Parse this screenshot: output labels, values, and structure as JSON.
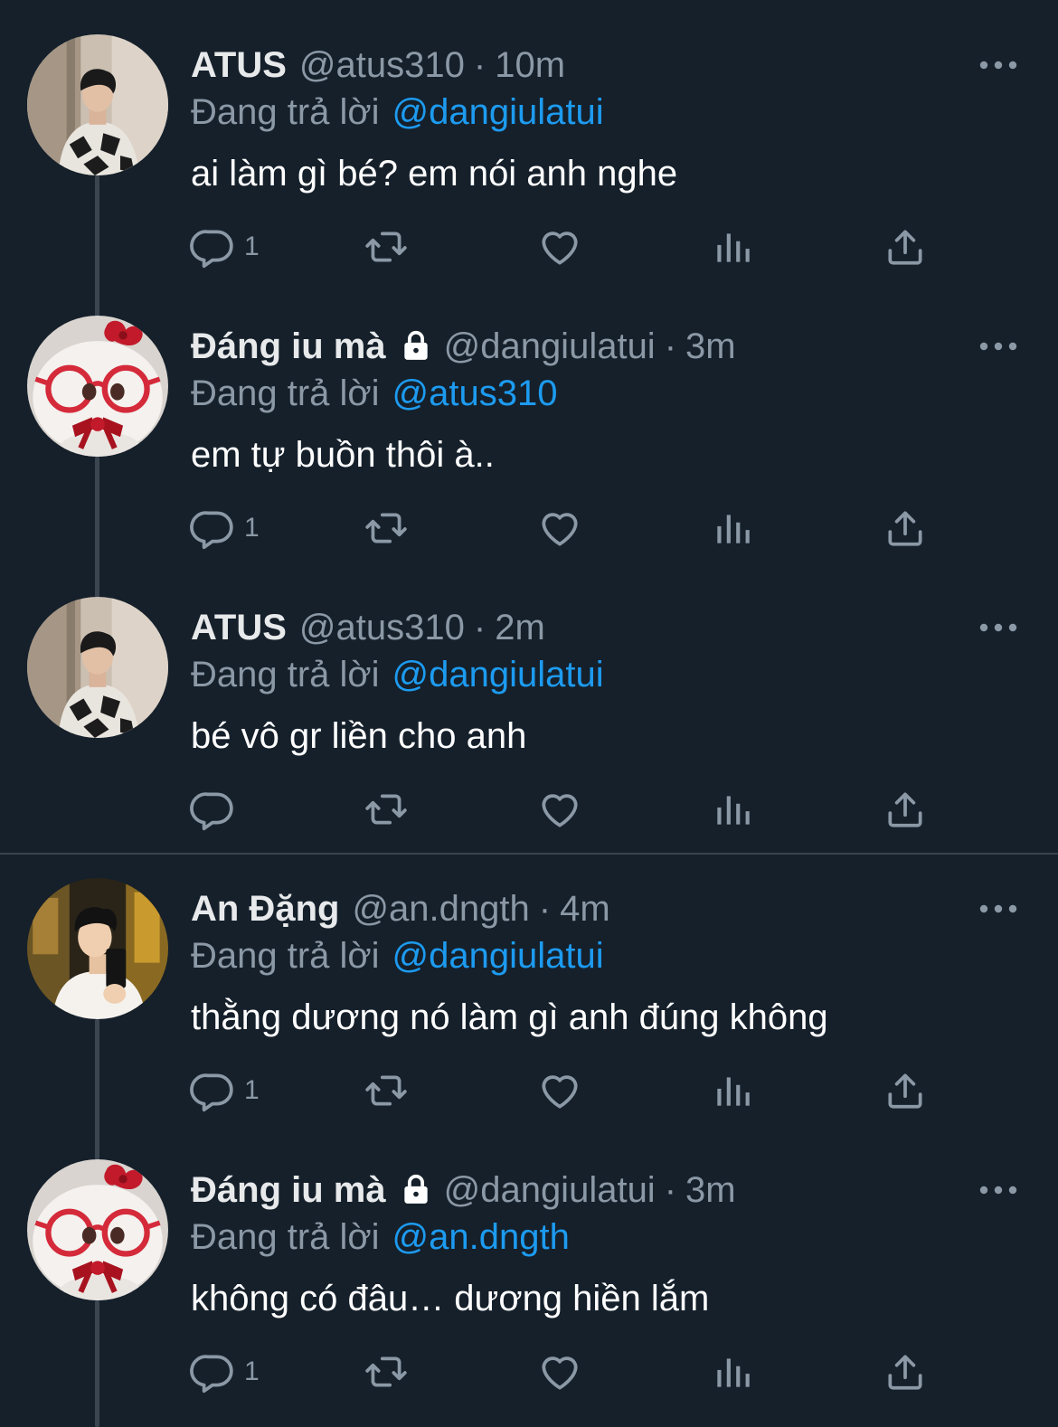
{
  "colors": {
    "background": "#15202b",
    "secondary_text": "#8b98a5",
    "mention": "#1d9bf0",
    "thread_line": "#3a4550"
  },
  "tweets": [
    {
      "name": "ATUS",
      "locked": false,
      "handle": "@atus310",
      "separator": "·",
      "time": "10m",
      "reply_label": "Đang trả lời",
      "reply_to": "@dangiulatui",
      "text": "ai làm gì bé? em nói anh nghe",
      "reply_count": "1",
      "avatar": "man-black-white-sweater"
    },
    {
      "name": "Đáng iu mà",
      "locked": true,
      "handle": "@dangiulatui",
      "separator": "·",
      "time": "3m",
      "reply_label": "Đang trả lời",
      "reply_to": "@atus310",
      "text": "em tự buồn thôi à..",
      "reply_count": "1",
      "avatar": "plush-red-glasses"
    },
    {
      "name": "ATUS",
      "locked": false,
      "handle": "@atus310",
      "separator": "·",
      "time": "2m",
      "reply_label": "Đang trả lời",
      "reply_to": "@dangiulatui",
      "text": "bé vô gr liền cho anh",
      "reply_count": "",
      "avatar": "man-black-white-sweater"
    },
    {
      "name": "An Đặng",
      "locked": false,
      "handle": "@an.dngth",
      "separator": "·",
      "time": "4m",
      "reply_label": "Đang trả lời",
      "reply_to": "@dangiulatui",
      "text": "thằng dương nó làm gì anh đúng không",
      "reply_count": "1",
      "avatar": "man-mirror-selfie"
    },
    {
      "name": "Đáng iu mà",
      "locked": true,
      "handle": "@dangiulatui",
      "separator": "·",
      "time": "3m",
      "reply_label": "Đang trả lời",
      "reply_to": "@an.dngth",
      "text": "không có đâu… dương hiền lắm",
      "reply_count": "1",
      "avatar": "plush-red-glasses"
    }
  ],
  "icons": {
    "more": "more-horizontal-icon",
    "reply": "reply-icon",
    "retweet": "retweet-icon",
    "like": "heart-icon",
    "views": "views-icon",
    "share": "share-icon",
    "lock": "lock-icon"
  }
}
